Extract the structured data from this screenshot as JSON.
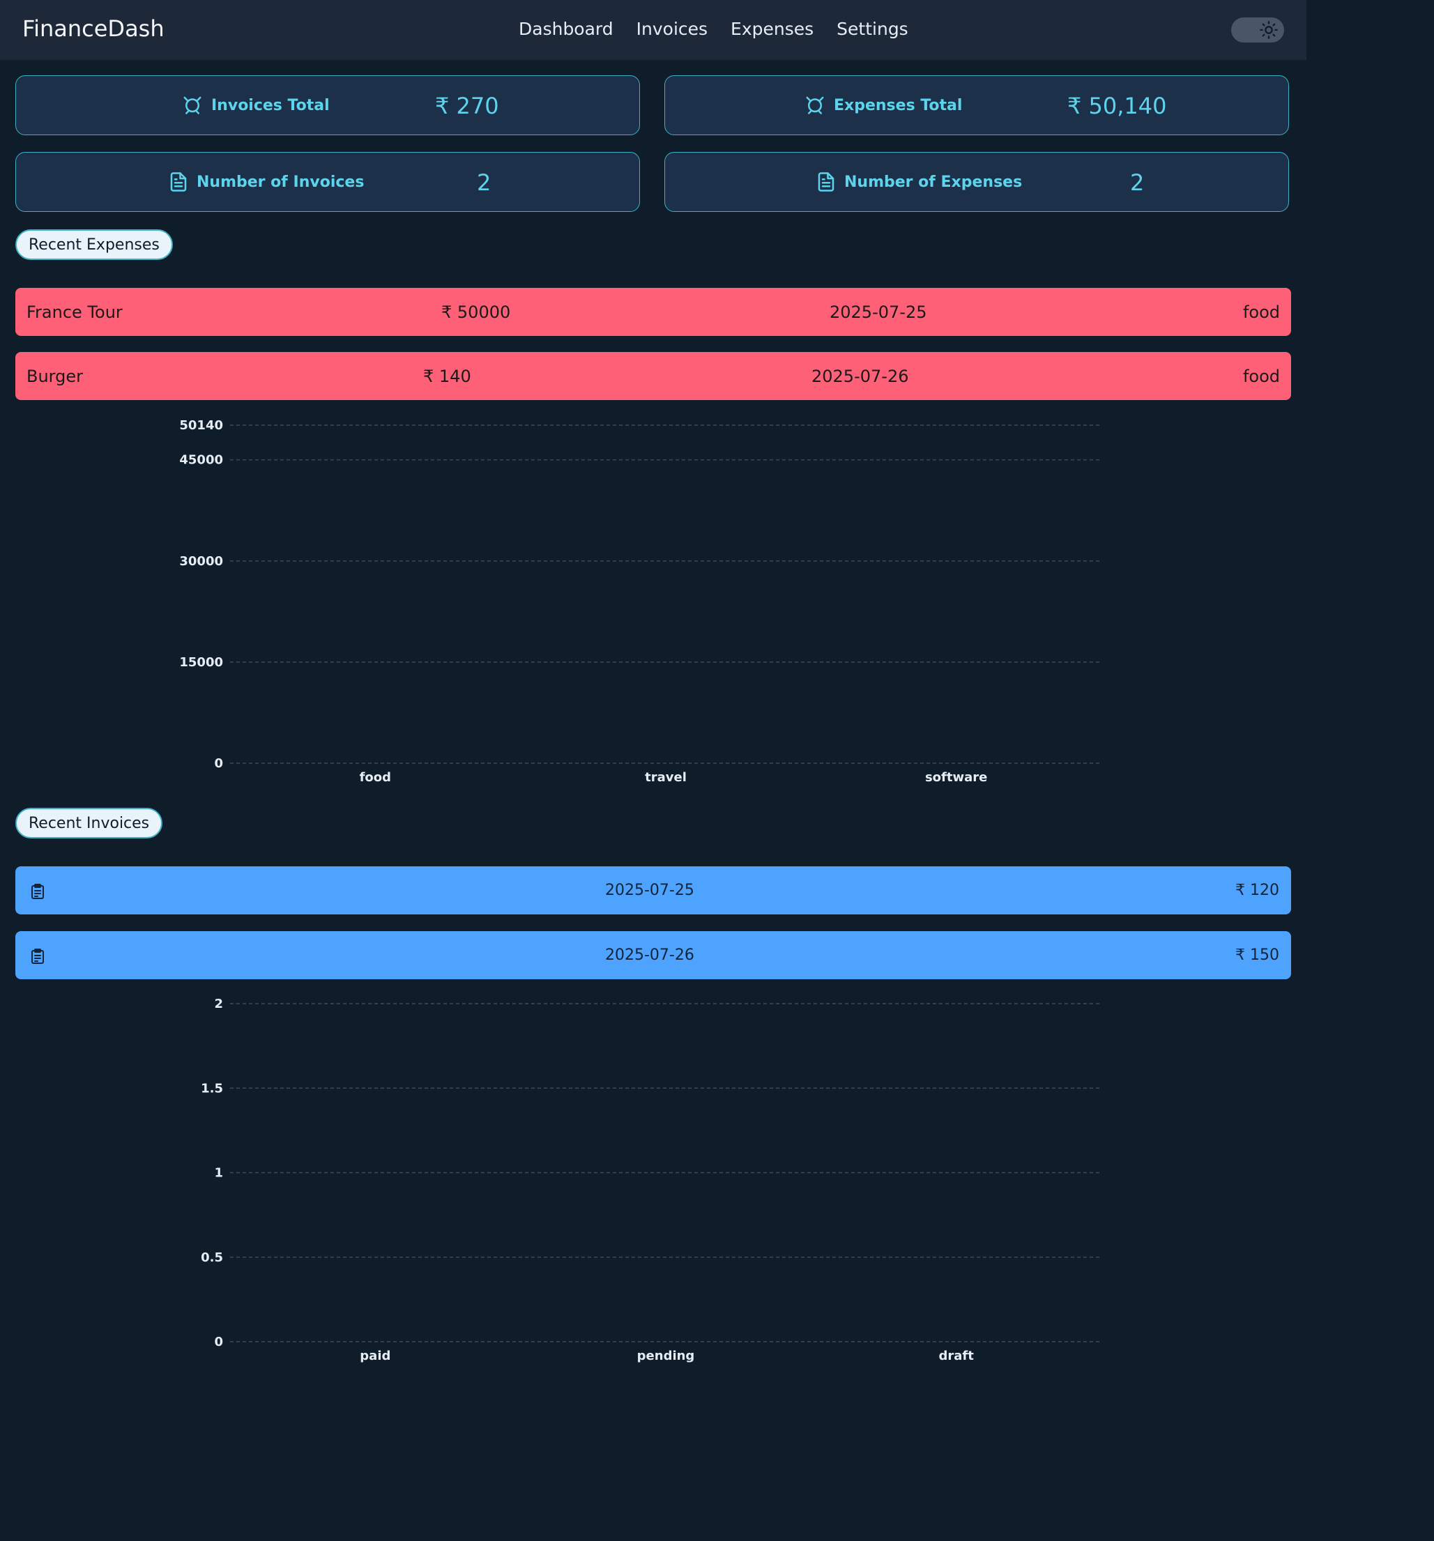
{
  "brand": "FinanceDash",
  "nav": [
    "Dashboard",
    "Invoices",
    "Expenses",
    "Settings"
  ],
  "theme_toggle_icon": "sun-icon",
  "cards": {
    "invoices_total": {
      "label": "Invoices Total",
      "value": "₹ 270",
      "icon": "alarm-icon"
    },
    "expenses_total": {
      "label": "Expenses Total",
      "value": "₹ 50,140",
      "icon": "alarm-icon"
    },
    "num_invoices": {
      "label": "Number of Invoices",
      "value": "2",
      "icon": "document-icon"
    },
    "num_expenses": {
      "label": "Number of Expenses",
      "value": "2",
      "icon": "document-icon"
    }
  },
  "recent_expenses": {
    "title": "Recent Expenses",
    "rows": [
      {
        "name": "France Tour",
        "amount": "₹ 50000",
        "date": "2025-07-25",
        "category": "food"
      },
      {
        "name": "Burger",
        "amount": "₹ 140",
        "date": "2025-07-26",
        "category": "food"
      }
    ]
  },
  "recent_invoices": {
    "title": "Recent Invoices",
    "rows": [
      {
        "date": "2025-07-25",
        "amount": "₹ 120",
        "icon": "clipboard-icon"
      },
      {
        "date": "2025-07-26",
        "amount": "₹ 150",
        "icon": "clipboard-icon"
      }
    ]
  },
  "colors": {
    "background": "#0f1c2a",
    "topbar": "#1d2838",
    "card_bg": "#1c3149",
    "accent": "#5ed3ec",
    "expense_row": "#fe6077",
    "invoice_row": "#4da3fe"
  },
  "chart_data": [
    {
      "type": "bar",
      "categories": [
        "food",
        "travel",
        "software"
      ],
      "values": [
        null,
        null,
        null
      ],
      "yticks": [
        0,
        15000,
        30000,
        45000,
        50140
      ],
      "ylim": [
        0,
        50140
      ],
      "grid": true
    },
    {
      "type": "bar",
      "categories": [
        "paid",
        "pending",
        "draft"
      ],
      "values": [
        null,
        null,
        null
      ],
      "yticks": [
        0,
        0.5,
        1,
        1.5,
        2
      ],
      "ylim": [
        0,
        2
      ],
      "grid": true
    }
  ]
}
